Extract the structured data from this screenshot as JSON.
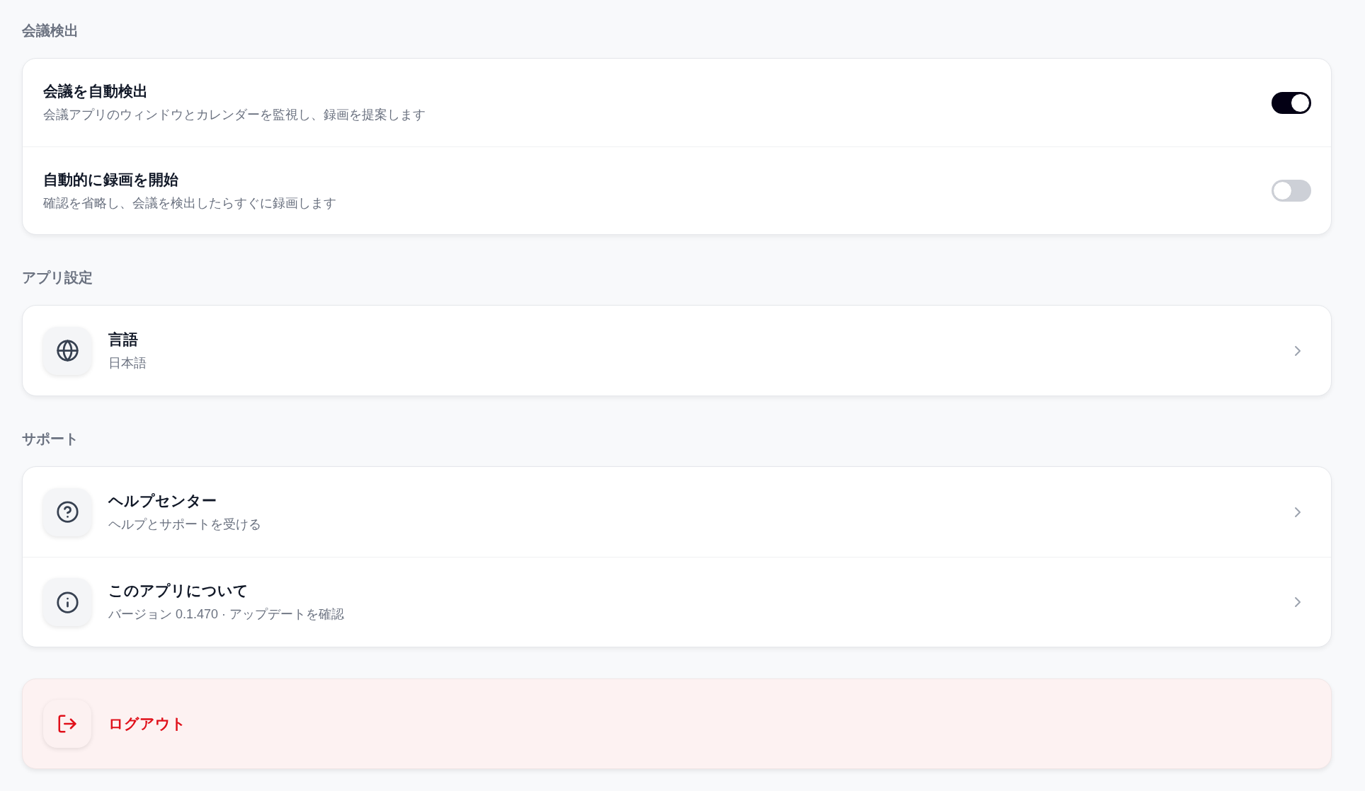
{
  "sections": [
    {
      "kind": "toggles",
      "title": "会議検出",
      "items": [
        {
          "title": "会議を自動検出",
          "description": "会議アプリのウィンドウとカレンダーを監視し、録画を提案します",
          "on": true
        },
        {
          "title": "自動的に録画を開始",
          "description": "確認を省略し、会議を検出したらすぐに録画します",
          "on": false
        }
      ]
    },
    {
      "kind": "links",
      "title": "アプリ設定",
      "items": [
        {
          "title": "言語",
          "description": "日本語"
        }
      ]
    },
    {
      "kind": "links",
      "title": "サポート",
      "items": [
        {
          "title": "ヘルプセンター",
          "description": "ヘルプとサポートを受ける"
        },
        {
          "title": "このアプリについて",
          "description": "バージョン 0.1.470 · アップデートを確認"
        }
      ]
    }
  ],
  "logout": {
    "label": "ログアウト"
  }
}
